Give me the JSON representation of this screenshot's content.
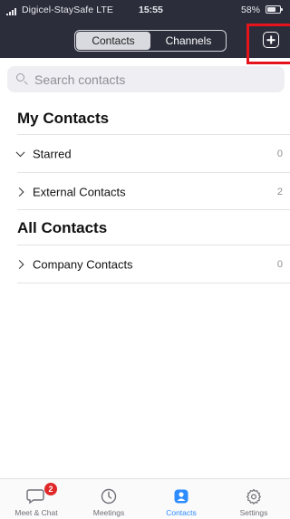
{
  "status_bar": {
    "carrier": "Digicel-StaySafe  LTE",
    "time": "15:55",
    "battery": "58%"
  },
  "header": {
    "tabs": [
      {
        "label": "Contacts",
        "active": true
      },
      {
        "label": "Channels",
        "active": false
      }
    ],
    "add_icon": "plus-square-icon",
    "highlight_color": "#e5141c"
  },
  "search": {
    "placeholder": "Search contacts"
  },
  "sections": [
    {
      "title": "My Contacts",
      "rows": [
        {
          "label": "Starred",
          "count": "0",
          "expanded": true
        },
        {
          "label": "External Contacts",
          "count": "2",
          "expanded": false
        }
      ]
    },
    {
      "title": "All Contacts",
      "rows": [
        {
          "label": "Company Contacts",
          "count": "0",
          "expanded": false
        }
      ]
    }
  ],
  "tabbar": {
    "items": [
      {
        "label": "Meet & Chat",
        "icon": "chat-bubble-icon",
        "badge": "2",
        "active": false
      },
      {
        "label": "Meetings",
        "icon": "clock-icon",
        "active": false
      },
      {
        "label": "Contacts",
        "icon": "contact-card-icon",
        "active": true
      },
      {
        "label": "Settings",
        "icon": "gear-icon",
        "active": false
      }
    ],
    "active_color": "#2d8cff"
  }
}
